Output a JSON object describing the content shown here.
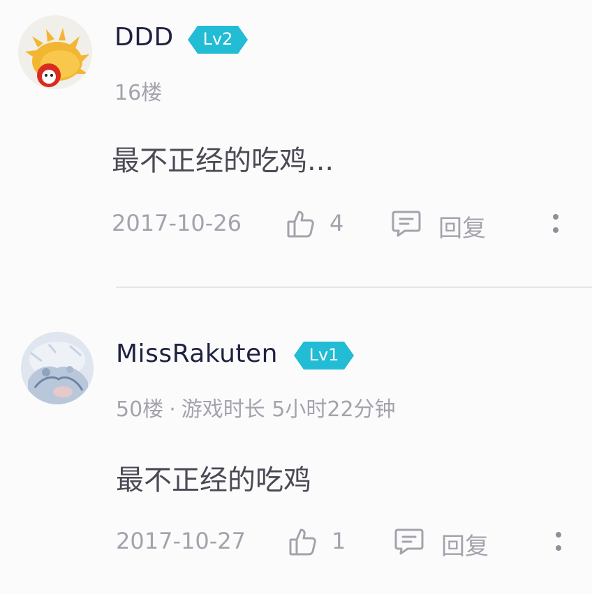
{
  "comments": [
    {
      "username": "DDD",
      "level": "Lv2",
      "floor": "16楼",
      "content": "最不正经的吃鸡...",
      "date": "2017-10-26",
      "likes": "4",
      "reply_label": "回复",
      "avatar_icon": "cartoon-avatar"
    },
    {
      "username": "MissRakuten",
      "level": "Lv1",
      "floor": "50楼",
      "separator": "·",
      "playtime_label": "游戏时长",
      "playtime_value": "5小时22分钟",
      "content": "最不正经的吃鸡",
      "date": "2017-10-27",
      "likes": "1",
      "reply_label": "回复",
      "avatar_icon": "anime-avatar"
    }
  ],
  "colors": {
    "badge": "#22bcd4",
    "username": "#1f2140",
    "muted": "#a3a3ad",
    "content": "#4a4a55"
  }
}
